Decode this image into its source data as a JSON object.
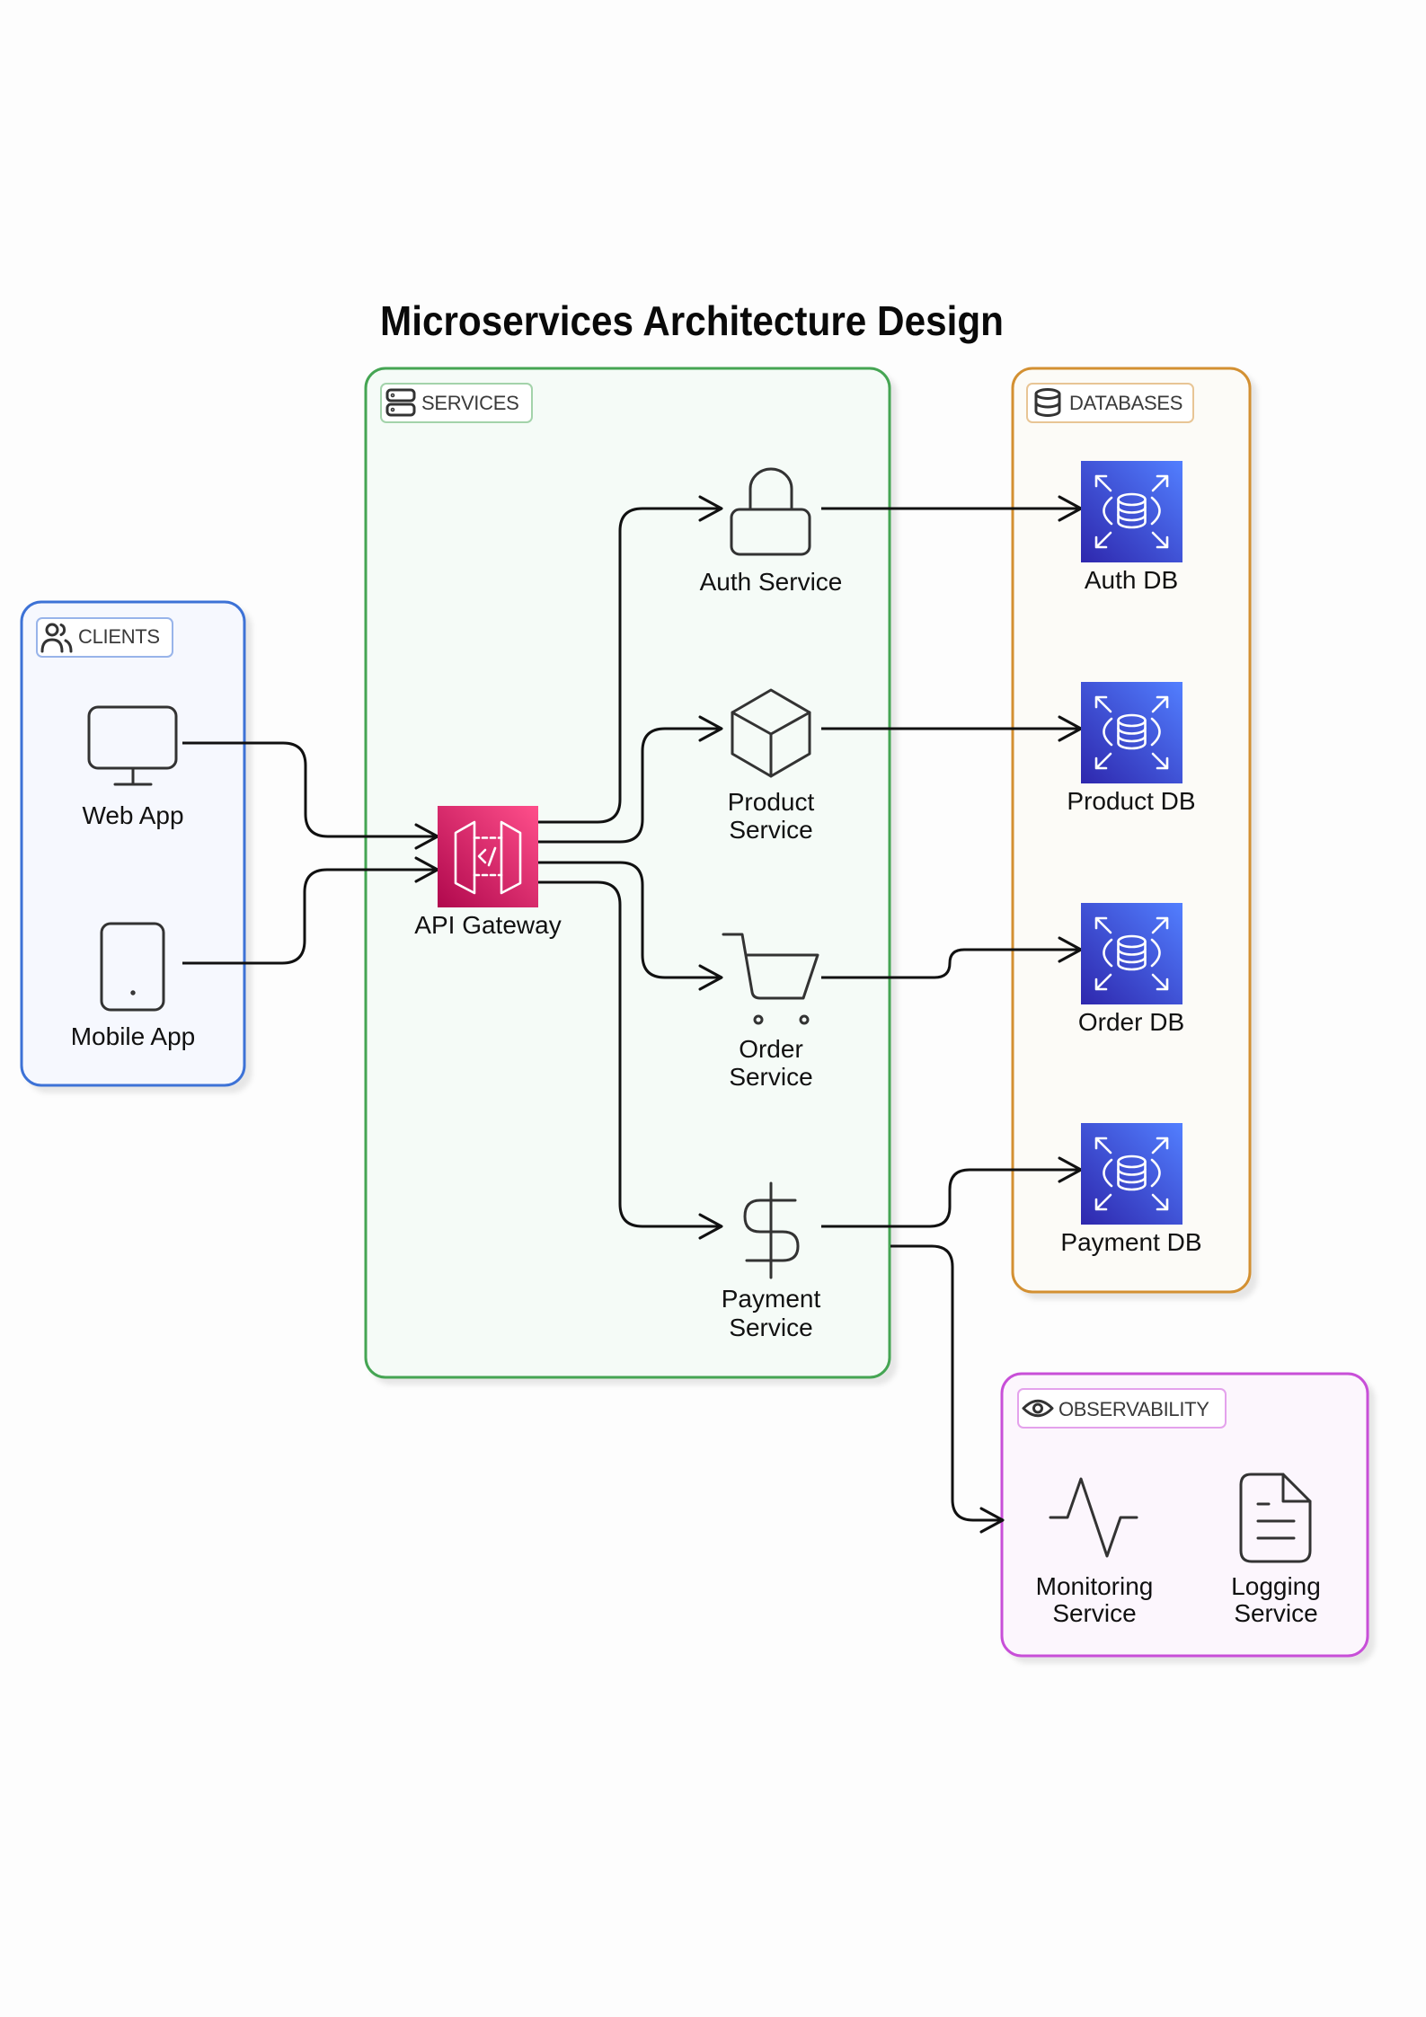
{
  "title": "Microservices Architecture Design",
  "colors": {
    "edge": "#111111",
    "icon_stroke": "#333333",
    "api_gateway_gradient": {
      "start": "#B0084D",
      "end": "#FF4F8B"
    },
    "database_gradient": {
      "start": "#2E27AD",
      "end": "#527FFF"
    }
  },
  "groups": {
    "clients": {
      "label": "CLIENTS",
      "icon": "users-icon",
      "border_color": "#3d72d6",
      "fill_color": "#f6f8fe",
      "label_border_color": "#98b4ea",
      "nodes": [
        {
          "label_lines": [
            "Web App"
          ],
          "icon": "monitor-icon"
        },
        {
          "label_lines": [
            "Mobile App"
          ],
          "icon": "tablet-icon"
        }
      ]
    },
    "services": {
      "label": "SERVICES",
      "icon": "server-icon",
      "border_color": "#45a553",
      "fill_color": "#f5fbf7",
      "label_border_color": "#a3d3aa",
      "nodes": [
        {
          "label_lines": [
            "API Gateway"
          ],
          "icon": "api-gateway-icon"
        },
        {
          "label_lines": [
            "Auth Service"
          ],
          "icon": "lock-icon"
        },
        {
          "label_lines": [
            "Product",
            "Service"
          ],
          "icon": "cube-icon"
        },
        {
          "label_lines": [
            "Order",
            "Service"
          ],
          "icon": "shopping-cart-icon"
        },
        {
          "label_lines": [
            "Payment",
            "Service"
          ],
          "icon": "dollar-icon"
        }
      ]
    },
    "databases": {
      "label": "DATABASES",
      "icon": "database-icon",
      "border_color": "#d39033",
      "fill_color": "#fcfbf7",
      "label_border_color": "#e8c595",
      "nodes": [
        {
          "label_lines": [
            "Auth DB"
          ],
          "icon": "rds-database-icon"
        },
        {
          "label_lines": [
            "Product DB"
          ],
          "icon": "rds-database-icon"
        },
        {
          "label_lines": [
            "Order DB"
          ],
          "icon": "rds-database-icon"
        },
        {
          "label_lines": [
            "Payment DB"
          ],
          "icon": "rds-database-icon"
        }
      ]
    },
    "observability": {
      "label": "OBSERVABILITY",
      "icon": "eye-icon",
      "border_color": "#c84fd8",
      "fill_color": "#fcf6fd",
      "label_border_color": "#e4a2ec",
      "nodes": [
        {
          "label_lines": [
            "Monitoring",
            "Service"
          ],
          "icon": "activity-icon"
        },
        {
          "label_lines": [
            "Logging",
            "Service"
          ],
          "icon": "file-text-icon"
        }
      ]
    }
  },
  "edges": [
    {
      "from": "Web App",
      "to": "API Gateway"
    },
    {
      "from": "Mobile App",
      "to": "API Gateway"
    },
    {
      "from": "API Gateway",
      "to": "Auth Service"
    },
    {
      "from": "API Gateway",
      "to": "Product Service"
    },
    {
      "from": "API Gateway",
      "to": "Order Service"
    },
    {
      "from": "API Gateway",
      "to": "Payment Service"
    },
    {
      "from": "Auth Service",
      "to": "Auth DB"
    },
    {
      "from": "Product Service",
      "to": "Product DB"
    },
    {
      "from": "Order Service",
      "to": "Order DB"
    },
    {
      "from": "Payment Service",
      "to": "Payment DB"
    },
    {
      "from": "Payment Service",
      "to": "Observability"
    }
  ]
}
